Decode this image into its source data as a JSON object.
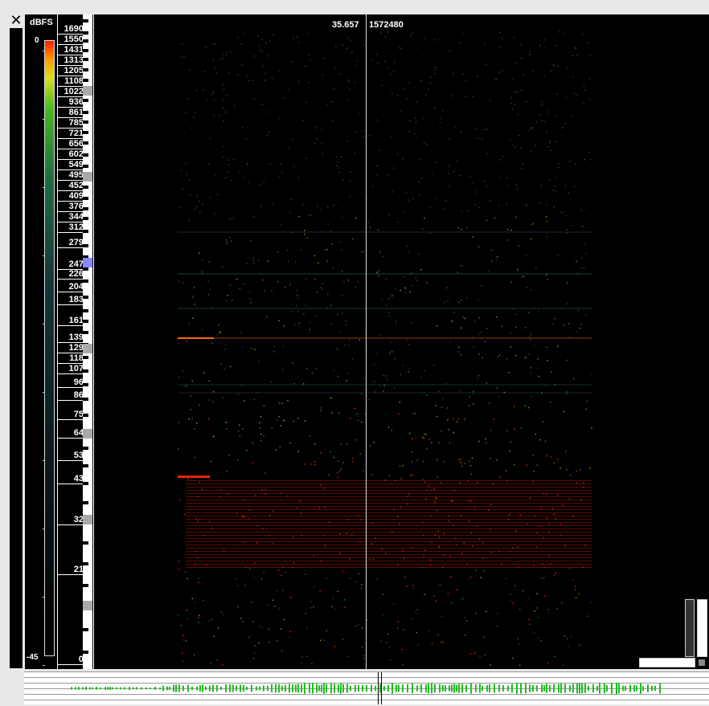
{
  "close_icon_glyph": "✕",
  "colorbar": {
    "unit": "dBFS",
    "max_label": "0",
    "min_label": "-45"
  },
  "freq_labels": [
    "1690",
    "1550",
    "1431",
    "1313",
    "1205",
    "1108",
    "1022",
    "936",
    "861",
    "785",
    "721",
    "656",
    "602",
    "549",
    "495",
    "452",
    "409",
    "376",
    "344",
    "312",
    "279",
    "247",
    "226",
    "204",
    "183",
    "161",
    "139",
    "129",
    "118",
    "107",
    "96",
    "86",
    "75",
    "64",
    "53",
    "43",
    "32",
    "21",
    "0"
  ],
  "cursor": {
    "time": "35.657",
    "sample": "1572480"
  },
  "colors": {
    "background": "#000000",
    "highlight_key": "#8888ff",
    "marker_key": "#aaaaaa",
    "waveform": "#22bb22"
  }
}
